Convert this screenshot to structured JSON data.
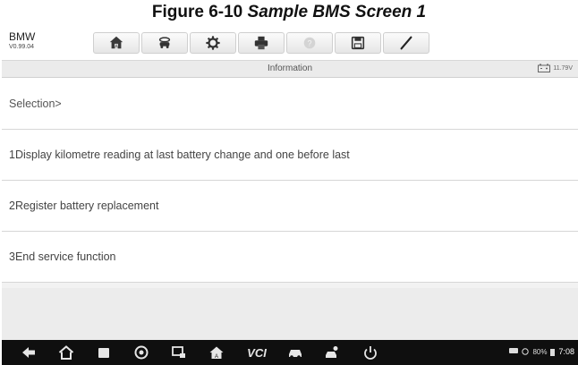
{
  "caption": {
    "prefix": "Figure 6-10 ",
    "italic": "Sample BMS Screen 1"
  },
  "toolbar": {
    "vehicle_make": "BMW",
    "version": "V0.99.04",
    "buttons": [
      "home-icon",
      "vehicle-swap-icon",
      "settings-icon",
      "print-icon",
      "help-icon",
      "save-icon",
      "edit-icon"
    ]
  },
  "titlebar": {
    "title": "Information",
    "battery_voltage": "11.79V"
  },
  "list": {
    "items": [
      "Selection>",
      "1Display kilometre reading at last battery change and one before last",
      "2Register battery replacement",
      "3End service function"
    ]
  },
  "navbar": {
    "icons": [
      "back-icon",
      "home-icon",
      "recent-apps-icon",
      "browser-icon",
      "screenshot-icon",
      "autel-home-icon",
      "vci-icon",
      "car-icon",
      "car-person-icon",
      "power-icon"
    ],
    "vci_label": "VCI",
    "battery_percent": "80%",
    "time": "7:08"
  },
  "colors": {
    "navbar": "#0f0f0f",
    "screen_bg": "#f2f2f2",
    "row_bg": "#ffffff"
  }
}
